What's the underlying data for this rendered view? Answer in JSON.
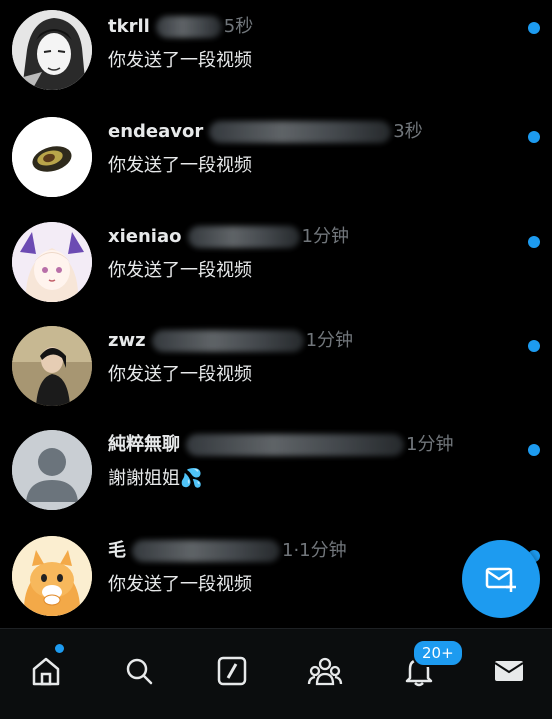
{
  "conversations": [
    {
      "name": "tkrll",
      "time": "5秒",
      "preview": "你发送了一段视频"
    },
    {
      "name": "endeavor",
      "time": "3秒",
      "preview": "你发送了一段视频"
    },
    {
      "name": "xieniao",
      "time": "1分钟",
      "preview": "你发送了一段视频"
    },
    {
      "name": "zwz",
      "time": "1分钟",
      "preview": "你发送了一段视频"
    },
    {
      "name": "純粹無聊",
      "time": "1分钟",
      "preview": "謝謝姐姐💦"
    },
    {
      "name": "毛",
      "time": "1·1分钟",
      "preview": "你发送了一段视频"
    }
  ],
  "tabbar": {
    "notifications_badge": "20+",
    "items": [
      "home-icon",
      "search-icon",
      "spaces-icon",
      "communities-icon",
      "notifications-icon",
      "messages-icon"
    ]
  },
  "colors": {
    "accent": "#1d9bf0",
    "background": "#000000",
    "muted": "#71767b"
  }
}
